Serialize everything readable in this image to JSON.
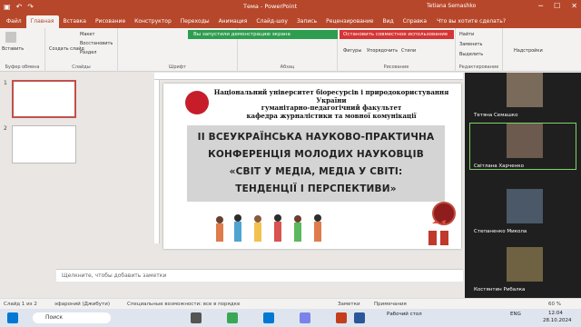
{
  "titlebar": {
    "doc_title": "Тема  -  PowerPoint",
    "user": "Tetiana Semashko",
    "winbtns": [
      "─",
      "☐",
      "✕"
    ]
  },
  "tabs": [
    "Файл",
    "Главная",
    "Вставка",
    "Рисование",
    "Конструктор",
    "Переходы",
    "Анимация",
    "Слайд-шоу",
    "Запись",
    "Рецензирование",
    "Вид",
    "Справка"
  ],
  "tell_me": "Что вы хотите сделать?",
  "ribbon": {
    "paste": "Вставить",
    "clipboard": "Буфер обмена",
    "new_slide": "Создать слайд",
    "layout": "Макет",
    "reset": "Восстановить",
    "section": "Раздел",
    "slides": "Слайды",
    "font": "Шрифт",
    "paragraph": "Абзац",
    "shapes": "Фигуры",
    "arrange": "Упорядочить",
    "styles": "Стили",
    "drawing": "Рисование",
    "find": "Найти",
    "replace": "Заменить",
    "select": "Выделить",
    "editing": "Редактирование",
    "addins": "Надстройки"
  },
  "notifications": {
    "green": "Вы запустили демонстрацию экрана",
    "red": "Остановить совместное использование"
  },
  "thumbnails": [
    {
      "num": "1"
    },
    {
      "num": "2"
    }
  ],
  "slide": {
    "header_lines": [
      "Національний університет біоресурсів і природокористування України",
      "гуманітарно-педагогічний факультет",
      "кафедра журналістики та мовної комунікації"
    ],
    "title_lines": [
      "ІІ ВСЕУКРАЇНСЬКА НАУКОВО-ПРАКТИЧНА",
      "КОНФЕРЕНЦІЯ МОЛОДИХ НАУКОВЦІВ",
      "«СВІТ У МЕДІА, МЕДІА У СВІТІ:",
      "ТЕНДЕНЦІЇ І ПЕРСПЕКТИВИ»"
    ]
  },
  "notes_placeholder": "Щелкните, чтобы добавить заметки",
  "participants": [
    {
      "name": "Тетяна Семашко",
      "color": "#7a6a5a"
    },
    {
      "name": "Світлана Харченко",
      "color": "#6b5a4d"
    },
    {
      "name": "Степаненко Микола",
      "color": "#4a5868"
    },
    {
      "name": "Костянтин Рибалка",
      "color": "#6e6242"
    }
  ],
  "status": {
    "slide": "Слайд 1 из 2",
    "theme": "эфароний (Джибути)",
    "accessibility": "Специальные возможности: все в порядке",
    "notes": "Заметки",
    "comments": "Примечания",
    "zoom": "60 %"
  },
  "taskbar": {
    "search": "Поиск",
    "desktop": "Рабочий стол",
    "lang": "ENG",
    "time": "12:04",
    "date": "28.10.2024"
  },
  "colors": {
    "accent": "#b7472a",
    "notif_green": "#2e9d4f",
    "notif_red": "#d53534"
  }
}
